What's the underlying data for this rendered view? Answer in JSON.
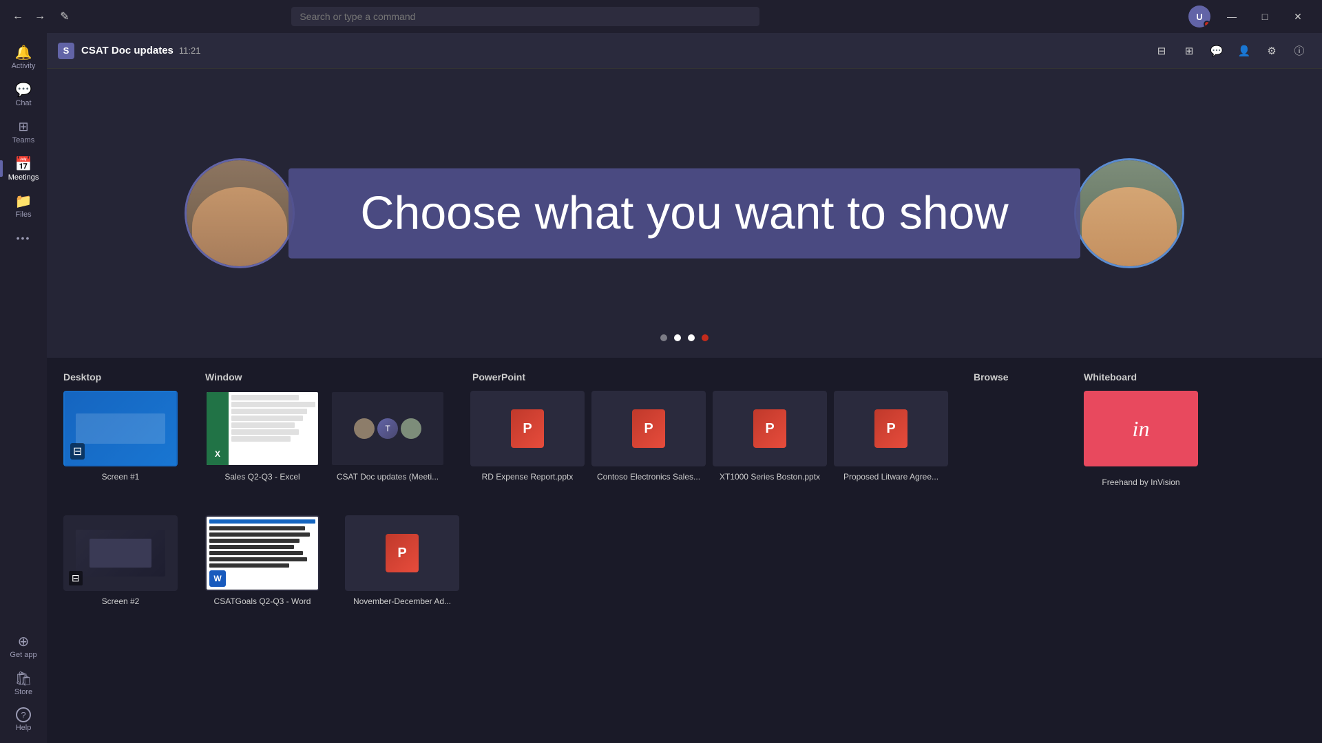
{
  "titlebar": {
    "search_placeholder": "Search or type a command",
    "back_label": "←",
    "forward_label": "→",
    "compose_label": "✎",
    "avatar_initials": "U",
    "minimize_label": "—",
    "maximize_label": "□",
    "close_label": "✕"
  },
  "sidebar": {
    "items": [
      {
        "id": "activity",
        "label": "Activity",
        "icon": "🔔",
        "active": false
      },
      {
        "id": "chat",
        "label": "Chat",
        "icon": "💬",
        "active": false
      },
      {
        "id": "teams",
        "label": "Teams",
        "icon": "⊞",
        "active": false
      },
      {
        "id": "meetings",
        "label": "Meetings",
        "icon": "📅",
        "active": true
      },
      {
        "id": "files",
        "label": "Files",
        "icon": "📁",
        "active": false
      },
      {
        "id": "more",
        "label": "...",
        "icon": "···",
        "active": false
      },
      {
        "id": "get-app",
        "label": "Get app",
        "icon": "⊕",
        "active": false
      },
      {
        "id": "store",
        "label": "Store",
        "icon": "🛍",
        "active": false
      },
      {
        "id": "help",
        "label": "Help",
        "icon": "?",
        "active": false
      }
    ]
  },
  "meeting": {
    "title": "CSAT Doc updates",
    "time": "11:21",
    "logo": "S"
  },
  "header_actions": [
    {
      "id": "screen-share",
      "icon": "⊟"
    },
    {
      "id": "whiteboard",
      "icon": "⊞"
    },
    {
      "id": "chat",
      "icon": "💬"
    },
    {
      "id": "participants",
      "icon": "⚙"
    },
    {
      "id": "settings",
      "icon": "⚙"
    },
    {
      "id": "info",
      "icon": "ⓘ"
    }
  ],
  "overlay": {
    "text": "Choose what you want to show"
  },
  "share_panel": {
    "sections": [
      {
        "id": "desktop",
        "title": "Desktop",
        "items": [
          {
            "id": "screen1",
            "label": "Screen #1"
          },
          {
            "id": "screen2",
            "label": "Screen #2"
          }
        ]
      },
      {
        "id": "window",
        "title": "Window",
        "items": [
          {
            "id": "excel",
            "label": "Sales Q2-Q3 - Excel"
          },
          {
            "id": "teams-meeting",
            "label": "CSAT Doc updates (Meeti..."
          }
        ]
      },
      {
        "id": "powerpoint",
        "title": "PowerPoint",
        "items": [
          {
            "id": "ppt1",
            "label": "RD Expense Report.pptx"
          },
          {
            "id": "ppt2",
            "label": "Contoso Electronics Sales..."
          },
          {
            "id": "ppt3",
            "label": "XT1000 Series Boston.pptx"
          },
          {
            "id": "ppt4",
            "label": "Proposed Litware Agree..."
          },
          {
            "id": "ppt5",
            "label": "November-December Ad..."
          }
        ]
      },
      {
        "id": "browse",
        "title": "Browse",
        "items": []
      },
      {
        "id": "whiteboard",
        "title": "Whiteboard",
        "items": [
          {
            "id": "freehand",
            "label": "Freehand by InVision"
          }
        ]
      }
    ]
  },
  "second_row": {
    "word_item": {
      "label": "CSATGoals Q2-Q3 - Word"
    },
    "ppt_row2": {
      "label": "November-December Ad..."
    }
  },
  "dots": [
    {
      "active": false
    },
    {
      "active": true
    },
    {
      "active": false
    },
    {
      "active": false,
      "red": true
    }
  ]
}
